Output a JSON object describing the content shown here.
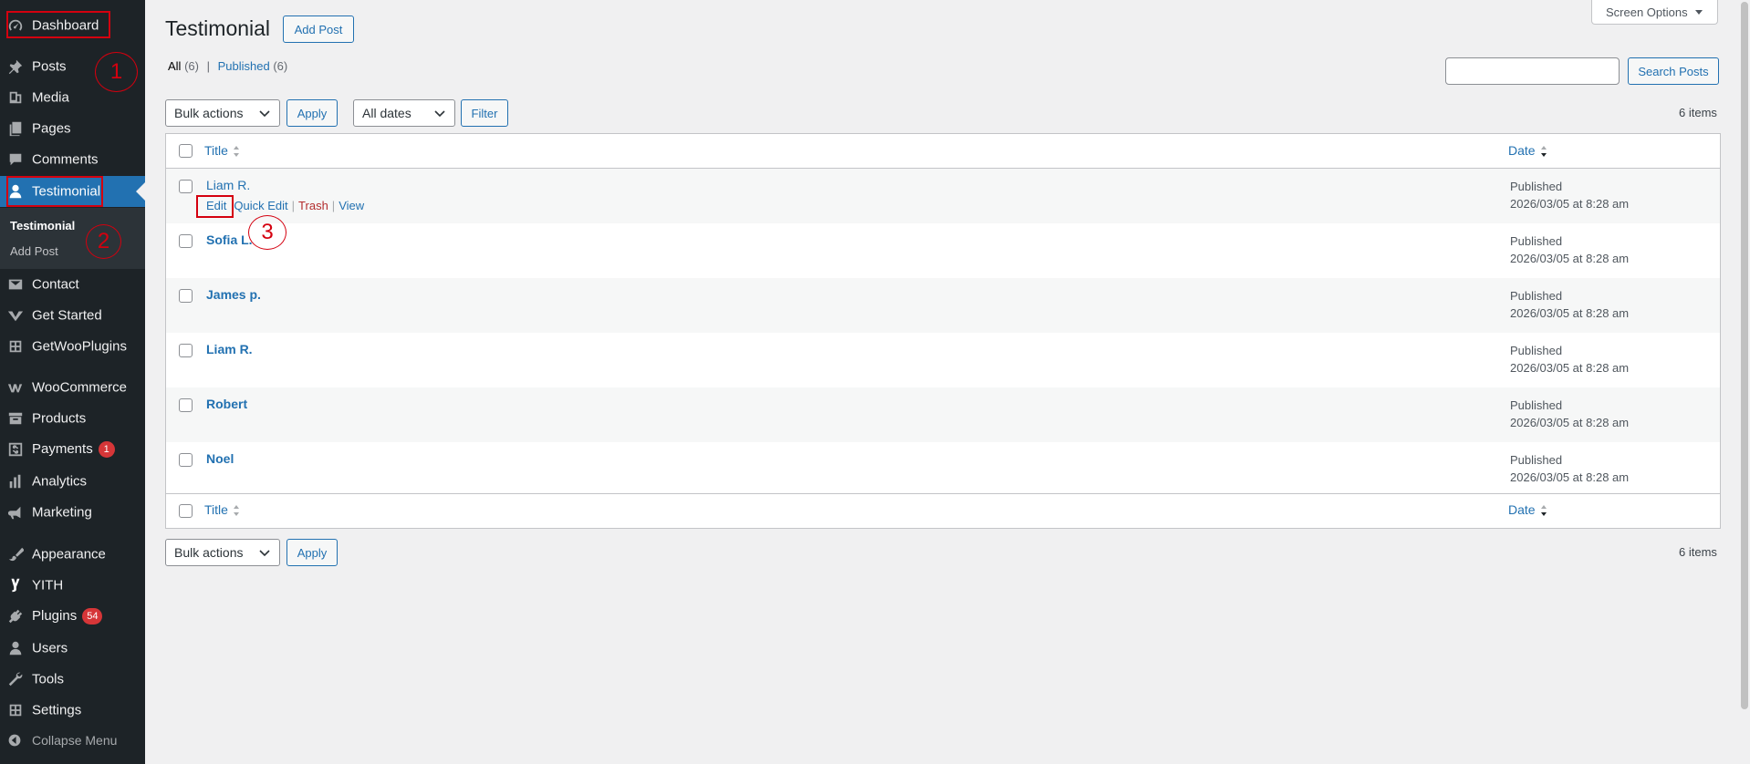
{
  "sidebar": {
    "items": [
      {
        "label": "Dashboard",
        "icon": "dashboard-icon"
      },
      {
        "label": "Posts",
        "icon": "pin-icon"
      },
      {
        "label": "Media",
        "icon": "media-icon"
      },
      {
        "label": "Pages",
        "icon": "pages-icon"
      },
      {
        "label": "Comments",
        "icon": "comments-icon"
      },
      {
        "label": "Testimonial",
        "icon": "user-icon"
      },
      {
        "label": "Contact",
        "icon": "mail-icon"
      },
      {
        "label": "Get Started",
        "icon": "get-started-icon"
      },
      {
        "label": "GetWooPlugins",
        "icon": "grid-icon"
      },
      {
        "label": "WooCommerce",
        "icon": "woocommerce-icon"
      },
      {
        "label": "Products",
        "icon": "archive-icon"
      },
      {
        "label": "Payments",
        "icon": "dollar-icon",
        "badge": "1"
      },
      {
        "label": "Analytics",
        "icon": "bar-chart-icon"
      },
      {
        "label": "Marketing",
        "icon": "megaphone-icon"
      },
      {
        "label": "Appearance",
        "icon": "brush-icon"
      },
      {
        "label": "YITH",
        "icon": "yith-icon"
      },
      {
        "label": "Plugins",
        "icon": "plug-icon",
        "badge": "54"
      },
      {
        "label": "Users",
        "icon": "users-icon"
      },
      {
        "label": "Tools",
        "icon": "wrench-icon"
      },
      {
        "label": "Settings",
        "icon": "settings-icon"
      }
    ],
    "submenu": [
      "Testimonial",
      "Add Post"
    ],
    "collapse_label": "Collapse Menu"
  },
  "annotations": [
    "1",
    "2",
    "3"
  ],
  "header": {
    "title": "Testimonial",
    "add_post": "Add Post",
    "screen_options": "Screen Options"
  },
  "views": {
    "all_label": "All",
    "all_count": "(6)",
    "separator": "|",
    "published_label": "Published",
    "published_count": "(6)"
  },
  "search": {
    "button": "Search Posts",
    "value": ""
  },
  "tablenav_top": {
    "bulk_actions": "Bulk actions",
    "apply": "Apply",
    "dates": "All dates",
    "filter": "Filter",
    "count": "6 items"
  },
  "table": {
    "col_title": "Title",
    "col_date": "Date",
    "rows": [
      {
        "title": "Liam R.",
        "status": "Published",
        "date": "2026/03/05 at 8:28 am"
      },
      {
        "title": "Sofia L.",
        "status": "Published",
        "date": "2026/03/05 at 8:28 am"
      },
      {
        "title": "James p.",
        "status": "Published",
        "date": "2026/03/05 at 8:28 am"
      },
      {
        "title": "Liam R.",
        "status": "Published",
        "date": "2026/03/05 at 8:28 am"
      },
      {
        "title": "Robert",
        "status": "Published",
        "date": "2026/03/05 at 8:28 am"
      },
      {
        "title": "Noel",
        "status": "Published",
        "date": "2026/03/05 at 8:28 am"
      }
    ],
    "row_actions": {
      "edit": "Edit",
      "quick_edit": "Quick Edit",
      "trash": "Trash",
      "view": "View",
      "sep": "|"
    }
  },
  "tablenav_bottom": {
    "bulk_actions": "Bulk actions",
    "apply": "Apply",
    "count": "6 items"
  },
  "colors": {
    "sidebar": "#1d2327",
    "accent": "#2271b1",
    "annotation": "#d4000f",
    "badge": "#d63638"
  }
}
